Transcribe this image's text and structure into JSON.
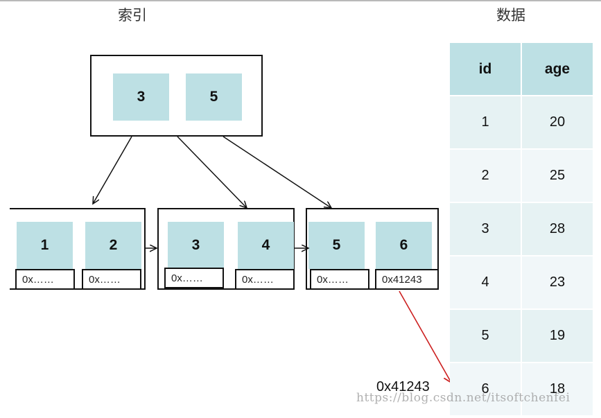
{
  "titles": {
    "index": "索引",
    "data": "数据"
  },
  "root_node": {
    "keys": [
      "3",
      "5"
    ]
  },
  "leaf_nodes": [
    {
      "keys": [
        "1",
        "2"
      ],
      "pointers": [
        "0x……",
        "0x……"
      ]
    },
    {
      "keys": [
        "3",
        "4"
      ],
      "pointers": [
        "0x……",
        "0x……"
      ]
    },
    {
      "keys": [
        "5",
        "6"
      ],
      "pointers": [
        "0x……",
        "0x41243"
      ]
    }
  ],
  "table": {
    "headers": [
      "id",
      "age"
    ],
    "rows": [
      [
        "1",
        "20"
      ],
      [
        "2",
        "25"
      ],
      [
        "3",
        "28"
      ],
      [
        "4",
        "23"
      ],
      [
        "5",
        "19"
      ],
      [
        "6",
        "18"
      ]
    ]
  },
  "address_label": "0x41243",
  "watermark": "https://blog.csdn.net/itsoftchenfei",
  "colors": {
    "key_fill": "#bde0e4",
    "pointer_arrow": "#cc1f1f",
    "edge": "#111111"
  }
}
